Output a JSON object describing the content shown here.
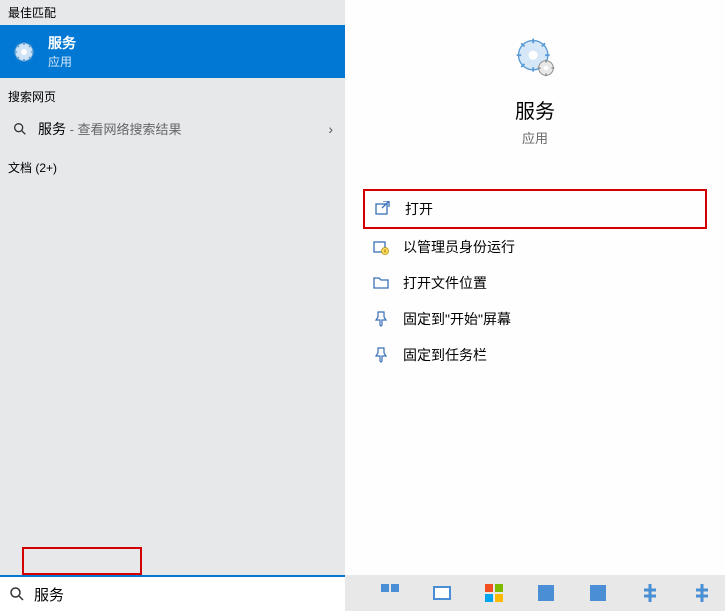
{
  "left": {
    "best_match_header": "最佳匹配",
    "best_match": {
      "title": "服务",
      "subtitle": "应用"
    },
    "web_header": "搜索网页",
    "web_item": {
      "query": "服务",
      "suffix": " - 查看网络搜索结果"
    },
    "docs_header": "文档 (2+)"
  },
  "right": {
    "title": "服务",
    "subtitle": "应用",
    "actions": {
      "open": "打开",
      "run_admin": "以管理员身份运行",
      "open_location": "打开文件位置",
      "pin_start": "固定到\"开始\"屏幕",
      "pin_taskbar": "固定到任务栏"
    }
  },
  "search": {
    "value": "服务"
  }
}
